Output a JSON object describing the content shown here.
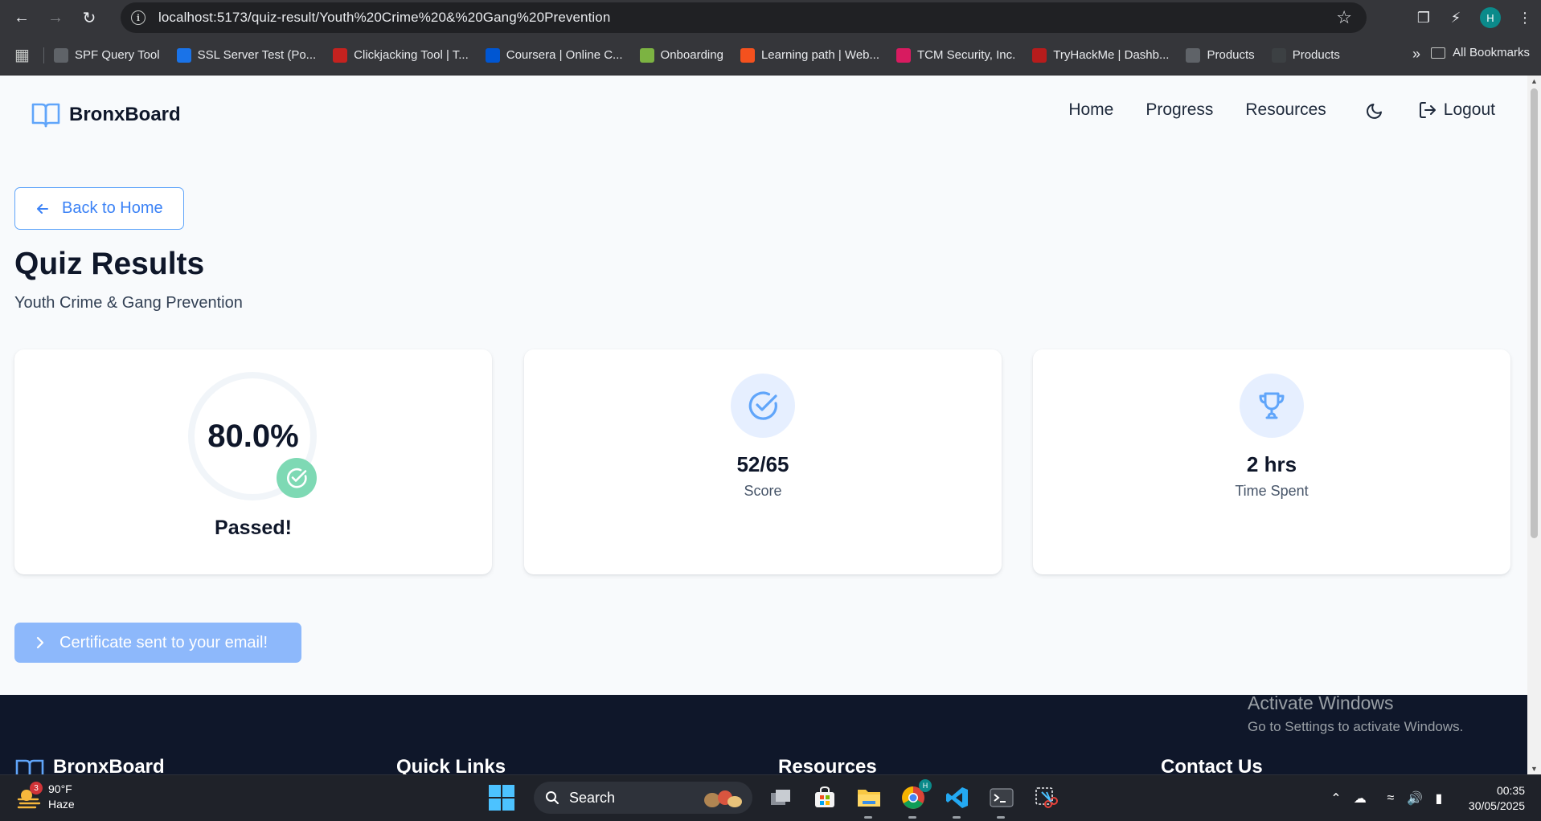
{
  "browser": {
    "url": "localhost:5173/quiz-result/Youth%20Crime%20&%20Gang%20Prevention",
    "profile_initial": "H",
    "bookmarks": [
      {
        "label": "SPF Query Tool",
        "color": "#5f6368"
      },
      {
        "label": "SSL Server Test (Po...",
        "color": "#1a73e8"
      },
      {
        "label": "Clickjacking Tool | T...",
        "color": "#c5221f"
      },
      {
        "label": "Coursera | Online C...",
        "color": "#0056d2"
      },
      {
        "label": "Onboarding",
        "color": "#7cb342"
      },
      {
        "label": "Learning path | Web...",
        "color": "#f4511e"
      },
      {
        "label": "TCM Security, Inc.",
        "color": "#d81b60"
      },
      {
        "label": "TryHackMe | Dashb...",
        "color": "#b71c1c"
      },
      {
        "label": "Products",
        "color": "#5f6368"
      },
      {
        "label": "Products",
        "color": "#3c4043"
      }
    ],
    "all_bookmarks_label": "All Bookmarks"
  },
  "header": {
    "brand": "BronxBoard",
    "nav": [
      "Home",
      "Progress",
      "Resources"
    ],
    "logout_label": "Logout"
  },
  "main": {
    "back_label": "Back to Home",
    "title": "Quiz Results",
    "subtitle": "Youth Crime & Gang Prevention",
    "score_percent": "80.0%",
    "score_fraction": 0.8,
    "status": "Passed!",
    "score_value": "52/65",
    "score_label": "Score",
    "time_value": "2 hrs",
    "time_label": "Time Spent",
    "certificate_label": "Certificate sent to your email!"
  },
  "footer": {
    "brand": "BronxBoard",
    "columns": [
      "Quick Links",
      "Resources",
      "Contact Us"
    ]
  },
  "watermark": {
    "line1": "Activate Windows",
    "line2": "Go to Settings to activate Windows."
  },
  "taskbar": {
    "weather_badge": "3",
    "temperature": "90°F",
    "condition": "Haze",
    "search_label": "Search",
    "chrome_badge": "H",
    "time": "00:35",
    "date": "30/05/2025"
  },
  "colors": {
    "accent": "#3b82f6",
    "pass_green": "#7ed9b4",
    "footer_bg": "#0f172a"
  }
}
